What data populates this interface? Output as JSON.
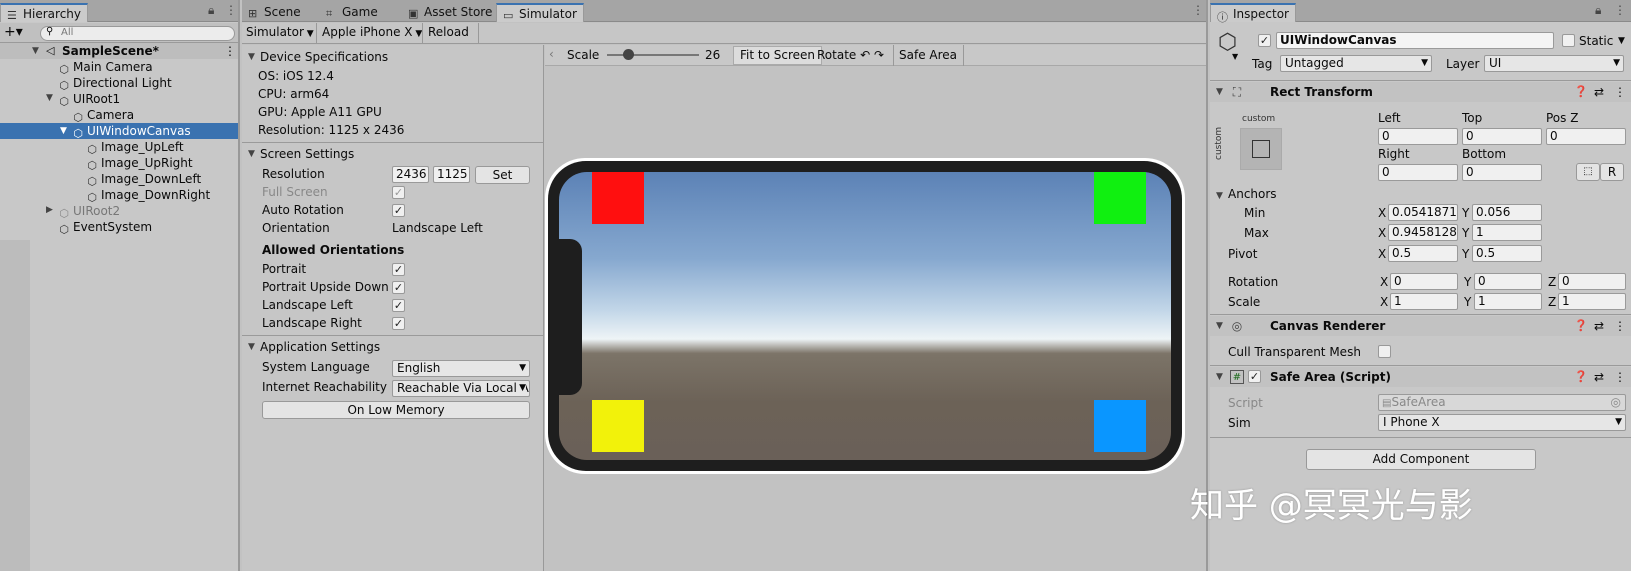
{
  "hierarchy": {
    "tab_label": "Hierarchy",
    "add_label": "+▾",
    "search_placeholder": "All",
    "scene_name": "SampleScene*",
    "items": [
      {
        "label": "Main Camera"
      },
      {
        "label": "Directional Light"
      },
      {
        "label": "UIRoot1"
      },
      {
        "label": "Camera"
      },
      {
        "label": "UIWindowCanvas"
      },
      {
        "label": "Image_UpLeft"
      },
      {
        "label": "Image_UpRight"
      },
      {
        "label": "Image_DownLeft"
      },
      {
        "label": "Image_DownRight"
      },
      {
        "label": "UIRoot2"
      },
      {
        "label": "EventSystem"
      }
    ]
  },
  "center": {
    "tabs": [
      {
        "label": "Scene"
      },
      {
        "label": "Game"
      },
      {
        "label": "Asset Store"
      },
      {
        "label": "Simulator"
      }
    ],
    "toolbar": {
      "mode": "Simulator",
      "device": "Apple iPhone X",
      "reload": "Reload"
    },
    "device_specs": {
      "heading": "Device Specifications",
      "os": "OS: iOS 12.4",
      "cpu": "CPU: arm64",
      "gpu": "GPU: Apple A11 GPU",
      "resolution": "Resolution: 1125 x 2436"
    },
    "screen_settings": {
      "heading": "Screen Settings",
      "resolution_label": "Resolution",
      "res_w": "2436",
      "res_h": "1125",
      "set_label": "Set",
      "full_screen": "Full Screen",
      "auto_rotation": "Auto Rotation",
      "orientation_label": "Orientation",
      "orientation_value": "Landscape Left",
      "allowed_heading": "Allowed Orientations",
      "portrait": "Portrait",
      "portrait_ud": "Portrait Upside Down",
      "landscape_left": "Landscape Left",
      "landscape_right": "Landscape Right"
    },
    "app_settings": {
      "heading": "Application Settings",
      "lang_label": "System Language",
      "lang_value": "English",
      "reach_label": "Internet Reachability",
      "reach_value": "Reachable Via Local A",
      "low_mem": "On Low Memory"
    },
    "viewport": {
      "scale_label": "Scale",
      "scale_value": "26",
      "scale_fraction": 0.14,
      "fit": "Fit to Screen",
      "rotate": "Rotate",
      "safe_area": "Safe Area",
      "squares": {
        "up_left": "#ff0f0f",
        "up_right": "#10f010",
        "down_left": "#f2f20a",
        "down_right": "#0a96ff"
      }
    }
  },
  "inspector": {
    "tab_label": "Inspector",
    "object_name": "UIWindowCanvas",
    "static_label": "Static",
    "tag_label": "Tag",
    "tag_value": "Untagged",
    "layer_label": "Layer",
    "layer_value": "UI",
    "rect_transform": {
      "title": "Rect Transform",
      "anchor_preset_label": "custom",
      "left_label": "Left",
      "left": "0",
      "top_label": "Top",
      "top": "0",
      "posz_label": "Pos Z",
      "posz": "0",
      "right_label": "Right",
      "right": "0",
      "bottom_label": "Bottom",
      "bottom": "0",
      "r_btn": "R",
      "anchors_label": "Anchors",
      "min_label": "Min",
      "min_x": "0.05418719",
      "min_y": "0.056",
      "max_label": "Max",
      "max_x": "0.9458128",
      "max_y": "1",
      "pivot_label": "Pivot",
      "pivot_x": "0.5",
      "pivot_y": "0.5",
      "rotation_label": "Rotation",
      "rot_x": "0",
      "rot_y": "0",
      "rot_z": "0",
      "scale_label": "Scale",
      "scale_x": "1",
      "scale_y": "1",
      "scale_z": "1",
      "x": "X",
      "y": "Y",
      "z": "Z"
    },
    "canvas_renderer": {
      "title": "Canvas Renderer",
      "cull_label": "Cull Transparent Mesh"
    },
    "safe_area": {
      "title": "Safe Area (Script)",
      "script_label": "Script",
      "script_value": "SafeArea",
      "sim_label": "Sim",
      "sim_value": "I Phone X"
    },
    "add_component": "Add Component"
  },
  "watermark": "知乎 @冥冥光与影"
}
